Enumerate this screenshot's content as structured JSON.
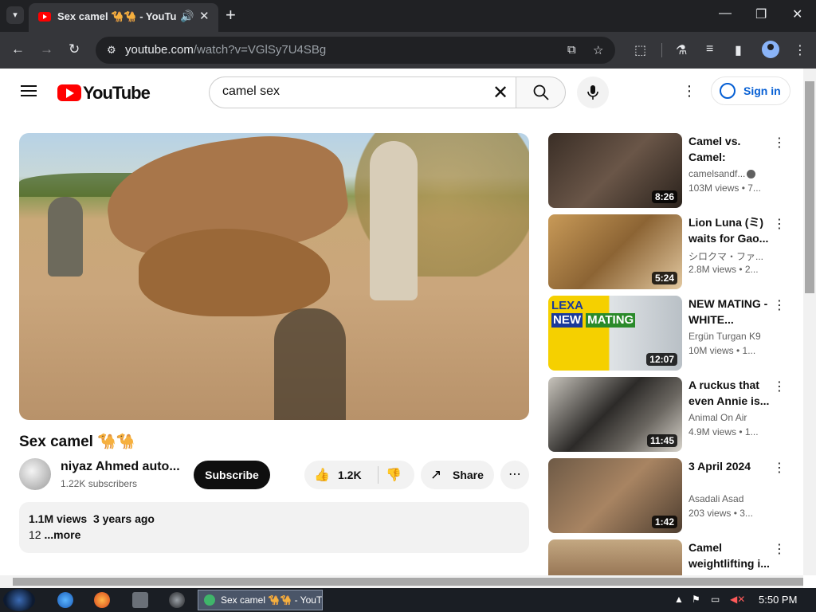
{
  "browser": {
    "tab_title": "Sex camel 🐪🐪 - YouTube",
    "url_host": "youtube.com",
    "url_path": "/watch?v=VGlSy7U4SBg",
    "icons": [
      "dropdown-icon",
      "audio-icon",
      "close-icon",
      "back-icon",
      "forward-icon",
      "reload-icon",
      "site-info-icon",
      "install-icon",
      "star-icon",
      "extensions-icon",
      "labs-icon",
      "media-icon",
      "sidepanel-icon",
      "profile-icon",
      "menu-icon"
    ]
  },
  "header": {
    "logo": "YouTube",
    "search_value": "camel sex",
    "sign_in": "Sign in"
  },
  "video": {
    "title": "Sex camel 🐪🐪",
    "channel": "niyaz Ahmed auto...",
    "subscribers": "1.22K subscribers",
    "subscribe_label": "Subscribe",
    "likes": "1.2K",
    "share_label": "Share",
    "views": "1.1M views",
    "age": "3 years ago",
    "desc_text": "12",
    "more_label": "...more"
  },
  "related": [
    {
      "title": "Camel vs. Camel: Anima...",
      "channel": "camelsandf...",
      "verified": true,
      "meta": "103M views • 7...",
      "duration": "8:26"
    },
    {
      "title": "Lion Luna (ミ) waits for Gao...",
      "channel": "シロクマ・ファ...",
      "verified": false,
      "meta": "2.8M views • 2...",
      "duration": "5:24"
    },
    {
      "title": "NEW MATING - WHITE...",
      "channel": "Ergün Turgan K9",
      "verified": false,
      "meta": "10M views • 1...",
      "duration": "12:07"
    },
    {
      "title": "A ruckus that even Annie is...",
      "channel": "Animal On Air",
      "verified": false,
      "meta": "4.9M views • 1...",
      "duration": "11:45"
    },
    {
      "title": "3 April 2024",
      "channel": "Asadali Asad",
      "verified": false,
      "meta": "203 views • 3...",
      "duration": "1:42"
    },
    {
      "title": "Camel weightlifting i...",
      "channel": "",
      "verified": false,
      "meta": "",
      "duration": ""
    }
  ],
  "thumb3_text": [
    "LEXA",
    "NEW",
    "MATING"
  ],
  "taskbar": {
    "task_label": "Sex camel 🐪🐪 - YouT...",
    "time": "5:50 PM"
  }
}
